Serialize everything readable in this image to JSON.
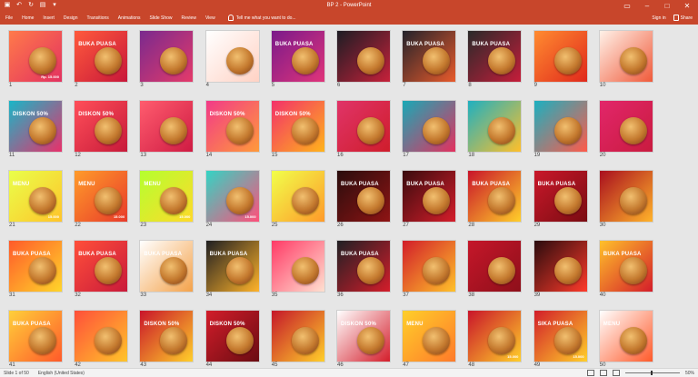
{
  "window": {
    "title": "BP 2  -  PowerPoint",
    "qat": [
      "save-icon",
      "undo-icon",
      "redo-icon",
      "present-icon",
      "customize-icon"
    ],
    "controls": [
      "ribbon-display-icon",
      "minimize-icon",
      "maximize-icon",
      "close-icon"
    ]
  },
  "ribbon": {
    "tabs": [
      "File",
      "Home",
      "Insert",
      "Design",
      "Transitions",
      "Animations",
      "Slide Show",
      "Review",
      "View"
    ],
    "tell_me": "Tell me what you want to do...",
    "sign_in": "Sign in",
    "share": "Share"
  },
  "colors": {
    "accent": "#c8462b",
    "background": "#e6e6e6"
  },
  "slides": [
    {
      "num": "1",
      "badge": "",
      "price": "Rp. 15.000",
      "bg": "linear-gradient(135deg,#ff7a4a,#e33160)"
    },
    {
      "num": "2",
      "badge": "BUKA PUASA",
      "price": "",
      "bg": "linear-gradient(135deg,#ff5a3c,#c8173a)"
    },
    {
      "num": "3",
      "badge": "",
      "price": "",
      "bg": "linear-gradient(135deg,#7a2a8e,#e43a6a)"
    },
    {
      "num": "4",
      "badge": "",
      "price": "",
      "bg": "linear-gradient(135deg,#ffffff,#ffd2c4)"
    },
    {
      "num": "5",
      "badge": "BUKA PUASA",
      "price": "",
      "bg": "linear-gradient(135deg,#7a1a8a,#e0347a)"
    },
    {
      "num": "6",
      "badge": "",
      "price": "",
      "bg": "linear-gradient(135deg,#1d1d24,#c6213a)"
    },
    {
      "num": "7",
      "badge": "BUKA PUASA",
      "price": "",
      "bg": "linear-gradient(135deg,#23232b,#e85a2b)"
    },
    {
      "num": "8",
      "badge": "BUKA PUASA",
      "price": "",
      "bg": "linear-gradient(135deg,#2a2a2a,#c51d3a)"
    },
    {
      "num": "9",
      "badge": "",
      "price": "",
      "bg": "linear-gradient(135deg,#ff8b30,#e0291c)"
    },
    {
      "num": "10",
      "badge": "",
      "price": "",
      "bg": "linear-gradient(135deg,#fff1e8,#f05a3a)"
    },
    {
      "num": "11",
      "badge": "DISKON 50%",
      "price": "",
      "bg": "linear-gradient(135deg,#19b6c7,#e8306a)"
    },
    {
      "num": "12",
      "badge": "DISKON 50%",
      "price": "",
      "bg": "linear-gradient(135deg,#ff4f59,#c71a3a)"
    },
    {
      "num": "13",
      "badge": "",
      "price": "",
      "bg": "linear-gradient(135deg,#ff5c6e,#cf1b43)"
    },
    {
      "num": "14",
      "badge": "DISKON 50%",
      "price": "",
      "bg": "linear-gradient(135deg,#f23a88,#ff9a3a)"
    },
    {
      "num": "15",
      "badge": "DISKON 50%",
      "price": "",
      "bg": "linear-gradient(135deg,#f3316a,#ffb31b)"
    },
    {
      "num": "16",
      "badge": "",
      "price": "",
      "bg": "linear-gradient(135deg,#e03468,#cf1d2b)"
    },
    {
      "num": "17",
      "badge": "",
      "price": "",
      "bg": "linear-gradient(135deg,#18a9b6,#e4305e)"
    },
    {
      "num": "18",
      "badge": "",
      "price": "",
      "bg": "linear-gradient(135deg,#1fb0c0,#ffbf2a)"
    },
    {
      "num": "19",
      "badge": "",
      "price": "",
      "bg": "linear-gradient(135deg,#1bb0c0,#ff5a4a)"
    },
    {
      "num": "20",
      "badge": "",
      "price": "",
      "bg": "linear-gradient(135deg,#e2266a,#c91b3f)"
    },
    {
      "num": "21",
      "badge": "MENU",
      "price": "15.000",
      "bg": "linear-gradient(135deg,#e9ff4a,#ffc42a)"
    },
    {
      "num": "22",
      "badge": "MENU",
      "price": "15.000",
      "bg": "linear-gradient(135deg,#ff9b2a,#e83b2a)"
    },
    {
      "num": "23",
      "badge": "MENU",
      "price": "15.000",
      "bg": "linear-gradient(135deg,#b4ff2f,#ffda2a)"
    },
    {
      "num": "24",
      "badge": "",
      "price": "15.000",
      "bg": "linear-gradient(135deg,#33d4c4,#ff4f7a)"
    },
    {
      "num": "25",
      "badge": "",
      "price": "",
      "bg": "linear-gradient(135deg,#f1ff4a,#ff9a2a)"
    },
    {
      "num": "26",
      "badge": "BUKA PUASA",
      "price": "",
      "bg": "linear-gradient(135deg,#2a0d0d,#8e1414)"
    },
    {
      "num": "27",
      "badge": "BUKA PUASA",
      "price": "",
      "bg": "linear-gradient(135deg,#3a0c0e,#d41d2a)"
    },
    {
      "num": "28",
      "badge": "BUKA PUASA",
      "price": "",
      "bg": "linear-gradient(135deg,#c9142a,#ffcf2a)"
    },
    {
      "num": "29",
      "badge": "BUKA PUASA",
      "price": "",
      "bg": "linear-gradient(135deg,#c9182a,#7a0c12)"
    },
    {
      "num": "30",
      "badge": "",
      "price": "",
      "bg": "linear-gradient(135deg,#a90f1f,#ffb32a)"
    },
    {
      "num": "31",
      "badge": "BUKA PUASA",
      "price": "",
      "bg": "linear-gradient(135deg,#ff5a2a,#ffd52a)"
    },
    {
      "num": "32",
      "badge": "BUKA PUASA",
      "price": "",
      "bg": "linear-gradient(135deg,#ff4f3a,#c91a3a)"
    },
    {
      "num": "33",
      "badge": "BUKA PUASA",
      "price": "",
      "bg": "linear-gradient(135deg,#ffffff,#f4a24a)"
    },
    {
      "num": "34",
      "badge": "BUKA PUASA",
      "price": "",
      "bg": "linear-gradient(135deg,#1f1f22,#ffb32a)"
    },
    {
      "num": "35",
      "badge": "",
      "price": "",
      "bg": "linear-gradient(135deg,#ff3a66,#ffe0d0)"
    },
    {
      "num": "36",
      "badge": "BUKA PUASA",
      "price": "",
      "bg": "linear-gradient(135deg,#202024,#d41d2a)"
    },
    {
      "num": "37",
      "badge": "",
      "price": "",
      "bg": "linear-gradient(135deg,#d21d2a,#ffc12a)"
    },
    {
      "num": "38",
      "badge": "",
      "price": "",
      "bg": "linear-gradient(135deg,#c5172a,#8e0f1a)"
    },
    {
      "num": "39",
      "badge": "",
      "price": "",
      "bg": "linear-gradient(135deg,#2a0c0e,#ff3a2a)"
    },
    {
      "num": "40",
      "badge": "BUKA PUASA",
      "price": "",
      "bg": "linear-gradient(135deg,#ffc12a,#d41d2a)"
    },
    {
      "num": "41",
      "badge": "BUKA PUASA",
      "price": "",
      "bg": "linear-gradient(135deg,#ffcf3a,#ff5a2a)"
    },
    {
      "num": "42",
      "badge": "",
      "price": "",
      "bg": "linear-gradient(135deg,#ff4f3a,#ffc42a)"
    },
    {
      "num": "43",
      "badge": "DISKON 50%",
      "price": "",
      "bg": "linear-gradient(135deg,#c9142a,#ffcf2a)"
    },
    {
      "num": "44",
      "badge": "DISKON 50%",
      "price": "",
      "bg": "linear-gradient(135deg,#d21d2a,#6a0c12)"
    },
    {
      "num": "45",
      "badge": "",
      "price": "",
      "bg": "linear-gradient(135deg,#c5172a,#ffcf2a)"
    },
    {
      "num": "46",
      "badge": "DISKON 50%",
      "price": "",
      "bg": "linear-gradient(135deg,#ffffff,#d41d2a)"
    },
    {
      "num": "47",
      "badge": "MENU",
      "price": "",
      "bg": "linear-gradient(135deg,#ffcf2a,#ff7a2a)"
    },
    {
      "num": "48",
      "badge": "",
      "price": "15.000",
      "bg": "linear-gradient(135deg,#c9142a,#ffcf2a)"
    },
    {
      "num": "49",
      "badge": "SIKA PUASA",
      "price": "15.000",
      "bg": "linear-gradient(135deg,#d21d2a,#ffcf2a)"
    },
    {
      "num": "50",
      "badge": "MENU",
      "price": "",
      "bg": "linear-gradient(135deg,#ffffff,#ff5a2a)"
    }
  ],
  "status": {
    "slide_info": "Slide 1 of 50",
    "language": "English (United States)",
    "zoom": "50%"
  }
}
